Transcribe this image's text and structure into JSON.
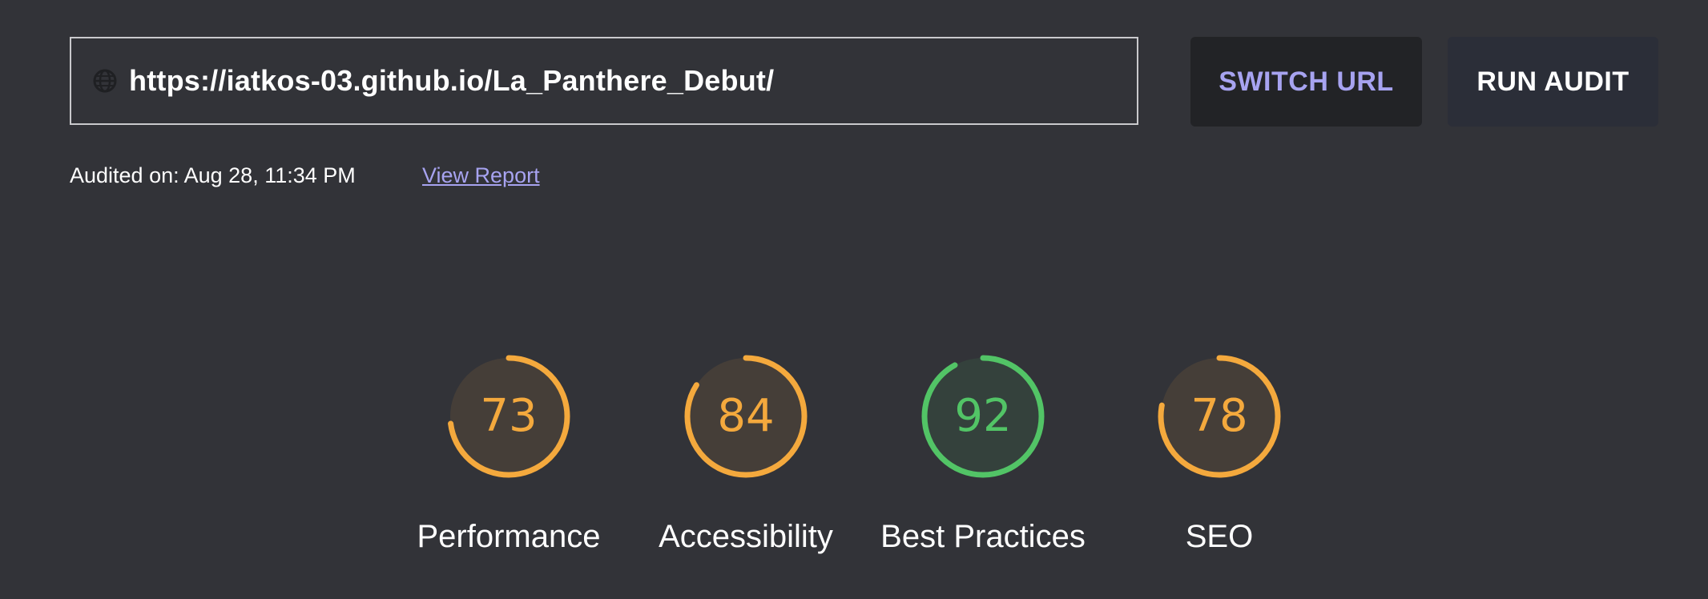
{
  "url_bar": {
    "icon": "globe-icon",
    "value": "https://iatkos-03.github.io/La_Panthere_Debut/"
  },
  "buttons": {
    "switch_url": "SWITCH URL",
    "run_audit": "RUN AUDIT"
  },
  "audit": {
    "audited_on": "Audited on: Aug 28, 11:34 PM",
    "view_report": "View Report"
  },
  "colors": {
    "background": "#323338",
    "accent": "#a7a3f0",
    "average": "#f4a93d",
    "good": "#52c466"
  },
  "scores": [
    {
      "label": "Performance",
      "score": "73",
      "rating": "average"
    },
    {
      "label": "Accessibility",
      "score": "84",
      "rating": "average"
    },
    {
      "label": "Best Practices",
      "score": "92",
      "rating": "good"
    },
    {
      "label": "SEO",
      "score": "78",
      "rating": "average"
    }
  ]
}
